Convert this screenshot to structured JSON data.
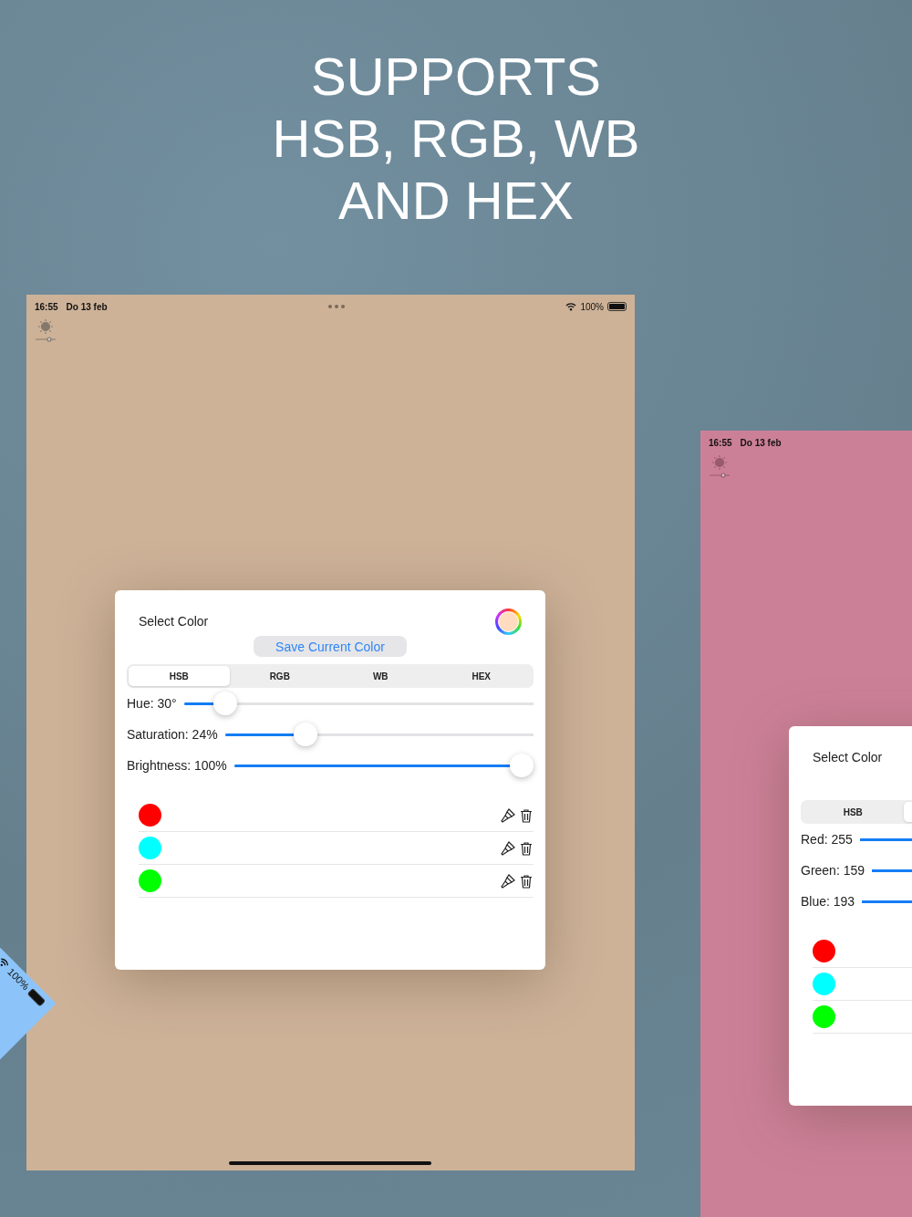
{
  "headline": [
    "SUPPORTS",
    "HSB, RGB, WB",
    "AND HEX"
  ],
  "tilted_screen": {
    "color": "#8cc4fa",
    "battery": "100%"
  },
  "main_screen": {
    "color": "#cdb298",
    "time": "16:55",
    "date": "Do 13 feb",
    "battery": "100%",
    "dialog": {
      "title": "Select Color",
      "save_button": "Save Current Color",
      "tabs": [
        {
          "label": "HSB",
          "selected": true
        },
        {
          "label": "RGB",
          "selected": false
        },
        {
          "label": "WB",
          "selected": false
        },
        {
          "label": "HEX",
          "selected": false
        }
      ],
      "sliders": [
        {
          "label": "Hue: 30°",
          "level": 0.09
        },
        {
          "label": "Saturation: 24%",
          "level": 0.24
        },
        {
          "label": "Brightness: 100%",
          "level": 1
        }
      ],
      "swatches": [
        {
          "color": "#ff0000"
        },
        {
          "color": "#00ffff"
        },
        {
          "color": "#00ff00"
        }
      ]
    }
  },
  "side_screen": {
    "color": "#cc8098",
    "time": "16:55",
    "date": "Do 13 feb",
    "dialog": {
      "title": "Select Color",
      "tabs": [
        {
          "label": "HSB",
          "selected": false
        },
        {
          "selected": true
        }
      ],
      "sliders": [
        {
          "label": "Red: 255"
        },
        {
          "label": "Green: 159"
        },
        {
          "label": "Blue: 193"
        }
      ],
      "swatches": [
        {
          "color": "#ff0000"
        },
        {
          "color": "#00ffff"
        },
        {
          "color": "#00ff00"
        }
      ]
    }
  }
}
